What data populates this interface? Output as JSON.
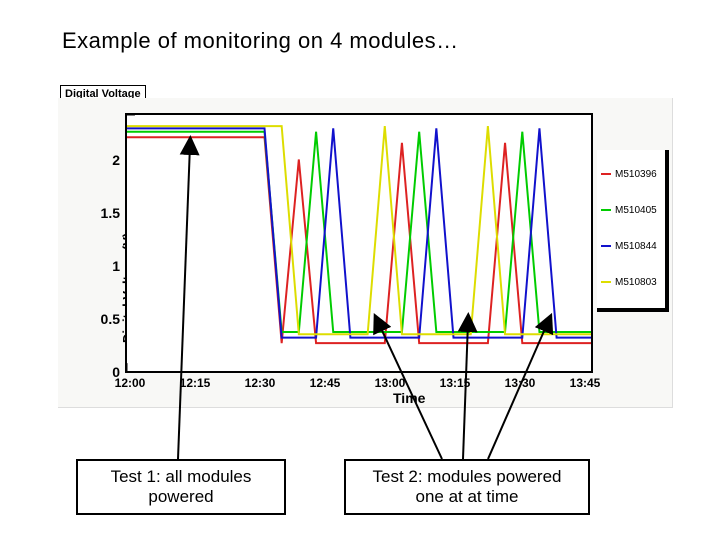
{
  "title": "Example of monitoring on 4 modules…",
  "boxed_label": "Digital Voltage",
  "ylabel": "Digital Voltage (V)",
  "xlabel": "Time",
  "y_ticks": [
    "0",
    "0.5",
    "1",
    "1.5",
    "2"
  ],
  "x_ticks": [
    "12:00",
    "12:15",
    "12:30",
    "12:45",
    "13:00",
    "13:15",
    "13:30",
    "13:45"
  ],
  "legend": [
    {
      "name": "M510396",
      "color": "#d22",
      "dash": true
    },
    {
      "name": "M510405",
      "color": "#0c0",
      "dash": true
    },
    {
      "name": "M510844",
      "color": "#11c",
      "dash": false
    },
    {
      "name": "M510803",
      "color": "#dd0",
      "dash": true
    }
  ],
  "annot1": "Test 1: all modules powered",
  "annot2": "Test 2: modules powered one at at time",
  "chart_data": {
    "type": "line",
    "title": "Digital Voltage",
    "xlabel": "Time",
    "ylabel": "Digital Voltage (V)",
    "ylim": [
      0,
      2.3
    ],
    "xlim": [
      "11:58",
      "13:47"
    ],
    "categories": [
      "12:00",
      "12:05",
      "12:10",
      "12:15",
      "12:20",
      "12:25",
      "12:30",
      "12:35",
      "12:40",
      "12:43",
      "12:45",
      "12:47",
      "12:50",
      "12:55",
      "13:00",
      "13:03",
      "13:05",
      "13:07",
      "13:10",
      "13:15",
      "13:20",
      "13:23",
      "13:25",
      "13:27",
      "13:30",
      "13:35",
      "13:40",
      "13:45"
    ],
    "series": [
      {
        "name": "M510396",
        "color": "#d22",
        "values": [
          2.1,
          2.1,
          2.1,
          2.1,
          2.1,
          2.1,
          2.1,
          2.1,
          2.1,
          0.25,
          1.9,
          0.25,
          0.25,
          0.25,
          0.25,
          0.25,
          2.05,
          0.25,
          0.25,
          0.25,
          0.25,
          0.25,
          2.05,
          0.25,
          0.25,
          0.25,
          0.25,
          0.25
        ]
      },
      {
        "name": "M510405",
        "color": "#0c0",
        "values": [
          2.15,
          2.15,
          2.15,
          2.15,
          2.15,
          2.15,
          2.15,
          2.15,
          2.15,
          0.35,
          0.35,
          2.15,
          0.35,
          0.35,
          0.35,
          0.35,
          0.35,
          2.15,
          0.35,
          0.35,
          0.35,
          0.35,
          0.35,
          2.15,
          0.35,
          0.35,
          0.35,
          0.35
        ]
      },
      {
        "name": "M510844",
        "color": "#11c",
        "values": [
          2.18,
          2.18,
          2.18,
          2.18,
          2.18,
          2.18,
          2.18,
          2.18,
          2.18,
          0.3,
          0.3,
          0.3,
          2.18,
          0.3,
          0.3,
          0.3,
          0.3,
          0.3,
          2.18,
          0.3,
          0.3,
          0.3,
          0.3,
          0.3,
          2.18,
          0.3,
          0.3,
          0.3
        ]
      },
      {
        "name": "M510803",
        "color": "#dd0",
        "values": [
          2.2,
          2.2,
          2.2,
          2.2,
          2.2,
          2.2,
          2.2,
          2.2,
          2.2,
          2.2,
          0.33,
          0.33,
          0.33,
          0.33,
          0.33,
          2.2,
          0.33,
          0.33,
          0.33,
          0.33,
          0.33,
          2.2,
          0.33,
          0.33,
          0.33,
          0.33,
          0.33,
          0.33
        ]
      }
    ],
    "annotations": [
      {
        "text": "Test 1: all modules powered",
        "points_to": "12:12"
      },
      {
        "text": "Test 2: modules powered one at at time",
        "points_to": [
          "12:50",
          "13:08",
          "13:27"
        ]
      }
    ]
  }
}
